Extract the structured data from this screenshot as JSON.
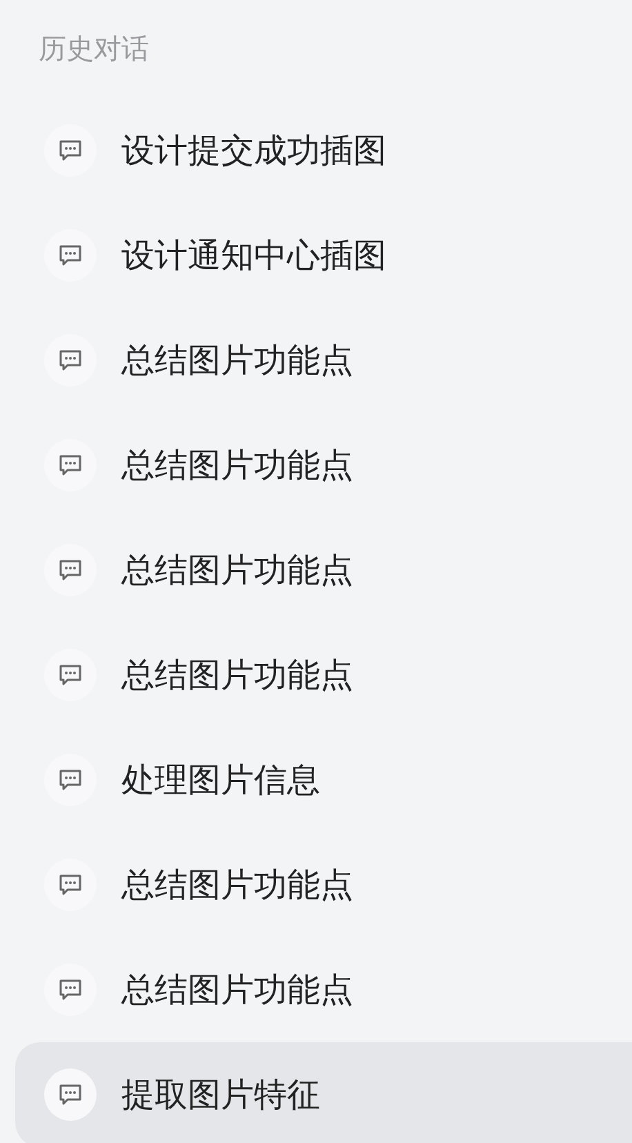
{
  "section_title": "历史对话",
  "items": [
    {
      "label": "设计提交成功插图",
      "selected": false
    },
    {
      "label": "设计通知中心插图",
      "selected": false
    },
    {
      "label": "总结图片功能点",
      "selected": false
    },
    {
      "label": "总结图片功能点",
      "selected": false
    },
    {
      "label": "总结图片功能点",
      "selected": false
    },
    {
      "label": "总结图片功能点",
      "selected": false
    },
    {
      "label": "处理图片信息",
      "selected": false
    },
    {
      "label": "总结图片功能点",
      "selected": false
    },
    {
      "label": "总结图片功能点",
      "selected": false
    },
    {
      "label": "提取图片特征",
      "selected": true
    }
  ]
}
